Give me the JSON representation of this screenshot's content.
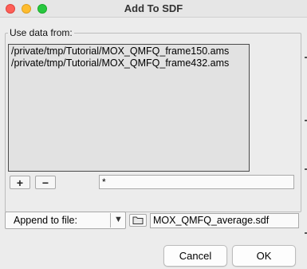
{
  "window": {
    "title": "Add To SDF"
  },
  "source_group": {
    "label": "Use data from:",
    "files": [
      "/private/tmp/Tutorial/MOX_QMFQ_frame150.ams",
      "/private/tmp/Tutorial/MOX_QMFQ_frame432.ams"
    ],
    "add_label": "+",
    "remove_label": "−",
    "filter_value": "*"
  },
  "output": {
    "mode_selected": "Append to file:",
    "file_value": "MOX_QMFQ_average.sdf"
  },
  "buttons": {
    "cancel": "Cancel",
    "ok": "OK"
  },
  "icons": {
    "combo_arrow": "chevron-down-icon",
    "browse": "folder-icon"
  },
  "colors": {
    "close": "#fe5f57",
    "minimize": "#febc2e",
    "maximize": "#28c840"
  }
}
